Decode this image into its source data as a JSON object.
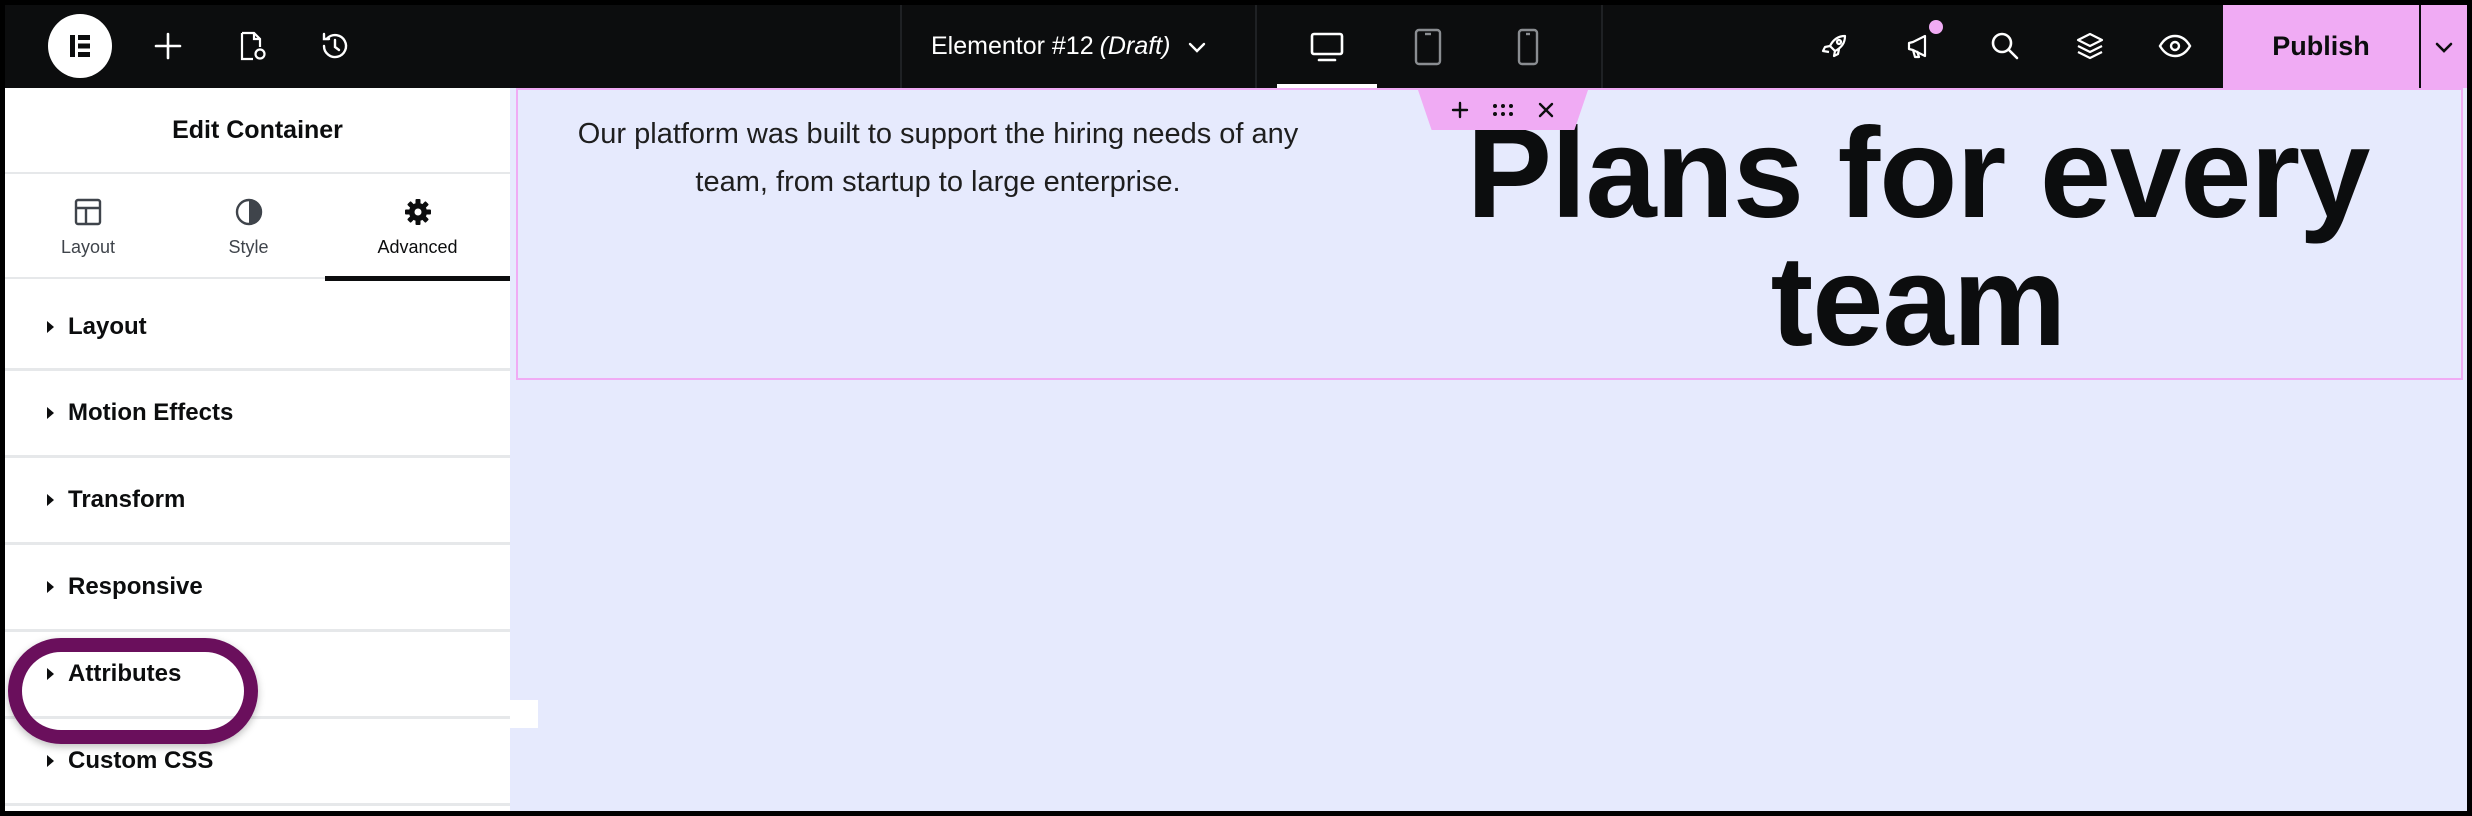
{
  "topbar": {
    "document_title": "Elementor #12",
    "document_status": "(Draft)",
    "publish_label": "Publish",
    "icons": [
      "elementor-logo-icon",
      "add-icon",
      "page-settings-icon",
      "history-icon",
      "desktop-icon",
      "tablet-icon",
      "mobile-icon",
      "rocket-icon",
      "megaphone-icon",
      "search-icon",
      "layers-icon",
      "eye-icon"
    ]
  },
  "panel": {
    "title": "Edit Container",
    "tabs": [
      {
        "label": "Layout",
        "icon": "layout-icon"
      },
      {
        "label": "Style",
        "icon": "style-icon"
      },
      {
        "label": "Advanced",
        "icon": "gear-icon",
        "active": true
      }
    ],
    "sections": [
      {
        "label": "Layout"
      },
      {
        "label": "Motion Effects"
      },
      {
        "label": "Transform"
      },
      {
        "label": "Responsive",
        "highlighted": true
      },
      {
        "label": "Attributes"
      },
      {
        "label": "Custom CSS"
      }
    ]
  },
  "canvas": {
    "description": "Our platform was built to support the hiring needs of any team, from startup to large enterprise.",
    "headline": "Plans for every team"
  },
  "colors": {
    "topbar_bg": "#0c0d0e",
    "accent": "#f0abf4",
    "canvas_bg": "#e6eafd",
    "highlight_ring": "#6a0f5c"
  }
}
